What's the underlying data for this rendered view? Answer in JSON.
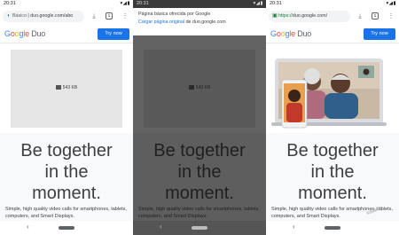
{
  "colors": {
    "accent": "#1a73e8",
    "placeholder_bg": "#e6e6e6",
    "dim_overlay": "#636363"
  },
  "logo": {
    "google": "Google",
    "product": "Duo",
    "google_colors": [
      "#4285F4",
      "#EA4335",
      "#FBBC05",
      "#4285F4",
      "#34A853",
      "#EA4335"
    ]
  },
  "phones": [
    {
      "status_time": "20:31",
      "status_icons": "▾◢▮",
      "url_basic": "Básico",
      "url_host": "duo.google.com/abo",
      "tab_count": "1",
      "try_button": "Try now",
      "image_size": "543 KB",
      "headline": [
        "Be together",
        "in the",
        "moment."
      ],
      "subtext": "Simple, high quality video calls for smartphones, tablets, computers, and Smart Displays."
    },
    {
      "status_time": "20:31",
      "status_icons": "▾◢▮",
      "banner_line1": "Página básica ofrecida por Google",
      "banner_link": "Cargar página original",
      "banner_rest": " de duo.google.com",
      "image_size": "543 KB",
      "headline": [
        "Be together",
        "in the",
        "moment."
      ],
      "subtext": "Simple, high quality video calls for smartphones, tablets, computers, and Smart Displays."
    },
    {
      "status_time": "20:31",
      "status_icons": "▾◢▮",
      "url_scheme": "https://",
      "url_host": "duo.google.com/",
      "tab_count": "1",
      "try_button": "Try now",
      "headline": [
        "Be together",
        "in the",
        "moment."
      ],
      "subtext": "Simple, high quality video calls for smartphones, tablets, computers, and Smart Displays.",
      "watermark": "xataka"
    }
  ],
  "icons": {
    "basic_mode": "basic-mode-icon",
    "lock": "lock-icon",
    "download": "download-icon",
    "menu": "more-vert-icon",
    "image": "image-placeholder-icon",
    "back": "back-icon",
    "home": "home-pill-icon"
  }
}
